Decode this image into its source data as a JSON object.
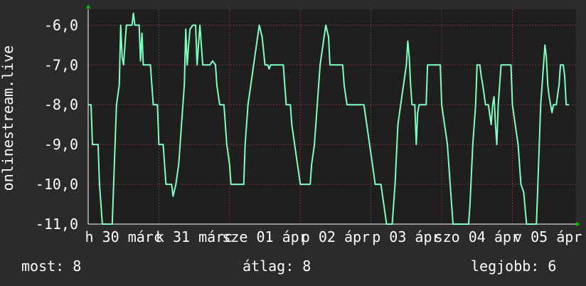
{
  "chart_data": {
    "type": "line",
    "ylabel": "onlinestream.live",
    "ylim": [
      -11,
      -5.6
    ],
    "yticks": [
      -6,
      -7,
      -8,
      -9,
      -10,
      -11
    ],
    "ytick_labels": [
      "-6,0",
      "-7,0",
      "-8,0",
      "-9,0",
      "-10,0",
      "-11,0"
    ],
    "xlim": [
      0,
      6.9
    ],
    "xtick_labels": [
      "h 30 márc",
      "k 31 márc",
      "sze 01 ápr",
      "p 02 ápr",
      "p 03 ápr",
      "szo 04 ápr",
      "v 05 ápr"
    ],
    "colors": {
      "background": "#2b2b2b",
      "plot_background": "#1f1f1f",
      "line": "#7fffc0",
      "grid": "#7a3a3a",
      "axis_arrow": "#00c000",
      "text": "#ffffff"
    },
    "series": [
      {
        "values": [
          [
            0.0,
            -8.0
          ],
          [
            0.04,
            -8.0
          ],
          [
            0.06,
            -9.0
          ],
          [
            0.14,
            -9.0
          ],
          [
            0.16,
            -10.0
          ],
          [
            0.2,
            -11.0
          ],
          [
            0.34,
            -11.0
          ],
          [
            0.36,
            -10.0
          ],
          [
            0.4,
            -8.0
          ],
          [
            0.44,
            -7.5
          ],
          [
            0.46,
            -6.0
          ],
          [
            0.48,
            -6.8
          ],
          [
            0.5,
            -7.0
          ],
          [
            0.52,
            -6.5
          ],
          [
            0.54,
            -6.0
          ],
          [
            0.6,
            -6.0
          ],
          [
            0.62,
            -6.0
          ],
          [
            0.64,
            -5.7
          ],
          [
            0.66,
            -6.0
          ],
          [
            0.72,
            -6.0
          ],
          [
            0.74,
            -6.9
          ],
          [
            0.76,
            -6.2
          ],
          [
            0.78,
            -7.0
          ],
          [
            0.88,
            -7.0
          ],
          [
            0.9,
            -7.5
          ],
          [
            0.92,
            -8.0
          ],
          [
            0.98,
            -8.0
          ],
          [
            1.0,
            -9.0
          ],
          [
            1.06,
            -9.0
          ],
          [
            1.08,
            -9.5
          ],
          [
            1.1,
            -10.0
          ],
          [
            1.18,
            -10.0
          ],
          [
            1.2,
            -10.3
          ],
          [
            1.24,
            -10.0
          ],
          [
            1.28,
            -9.5
          ],
          [
            1.32,
            -8.5
          ],
          [
            1.36,
            -7.5
          ],
          [
            1.38,
            -6.1
          ],
          [
            1.4,
            -7.0
          ],
          [
            1.42,
            -6.5
          ],
          [
            1.44,
            -6.1
          ],
          [
            1.48,
            -6.0
          ],
          [
            1.52,
            -6.0
          ],
          [
            1.54,
            -7.0
          ],
          [
            1.58,
            -6.0
          ],
          [
            1.62,
            -7.0
          ],
          [
            1.72,
            -7.0
          ],
          [
            1.76,
            -6.9
          ],
          [
            1.8,
            -7.0
          ],
          [
            1.82,
            -7.5
          ],
          [
            1.86,
            -8.0
          ],
          [
            1.92,
            -8.0
          ],
          [
            1.96,
            -9.0
          ],
          [
            2.0,
            -9.5
          ],
          [
            2.02,
            -10.0
          ],
          [
            2.2,
            -10.0
          ],
          [
            2.22,
            -9.0
          ],
          [
            2.26,
            -8.0
          ],
          [
            2.3,
            -7.5
          ],
          [
            2.34,
            -7.0
          ],
          [
            2.38,
            -6.5
          ],
          [
            2.42,
            -6.0
          ],
          [
            2.46,
            -6.3
          ],
          [
            2.5,
            -7.0
          ],
          [
            2.54,
            -7.0
          ],
          [
            2.56,
            -7.1
          ],
          [
            2.58,
            -7.0
          ],
          [
            2.76,
            -7.0
          ],
          [
            2.8,
            -8.0
          ],
          [
            2.86,
            -8.0
          ],
          [
            2.88,
            -8.5
          ],
          [
            2.92,
            -9.0
          ],
          [
            2.96,
            -9.5
          ],
          [
            3.0,
            -10.0
          ],
          [
            3.14,
            -10.0
          ],
          [
            3.16,
            -9.5
          ],
          [
            3.2,
            -9.0
          ],
          [
            3.24,
            -8.0
          ],
          [
            3.28,
            -7.0
          ],
          [
            3.32,
            -6.5
          ],
          [
            3.36,
            -6.0
          ],
          [
            3.4,
            -6.3
          ],
          [
            3.42,
            -7.0
          ],
          [
            3.6,
            -7.0
          ],
          [
            3.62,
            -7.5
          ],
          [
            3.66,
            -8.0
          ],
          [
            3.9,
            -8.0
          ],
          [
            3.94,
            -8.5
          ],
          [
            3.98,
            -9.0
          ],
          [
            4.02,
            -9.5
          ],
          [
            4.06,
            -10.0
          ],
          [
            4.14,
            -10.0
          ],
          [
            4.18,
            -10.5
          ],
          [
            4.22,
            -11.0
          ],
          [
            4.3,
            -11.0
          ],
          [
            4.34,
            -10.0
          ],
          [
            4.38,
            -8.5
          ],
          [
            4.42,
            -8.0
          ],
          [
            4.46,
            -7.5
          ],
          [
            4.5,
            -7.0
          ],
          [
            4.52,
            -6.4
          ],
          [
            4.54,
            -6.8
          ],
          [
            4.56,
            -7.5
          ],
          [
            4.58,
            -8.0
          ],
          [
            4.62,
            -8.0
          ],
          [
            4.64,
            -9.0
          ],
          [
            4.66,
            -8.2
          ],
          [
            4.68,
            -8.0
          ],
          [
            4.78,
            -8.0
          ],
          [
            4.8,
            -7.0
          ],
          [
            4.98,
            -7.0
          ],
          [
            5.0,
            -8.0
          ],
          [
            5.04,
            -8.5
          ],
          [
            5.08,
            -9.0
          ],
          [
            5.12,
            -10.0
          ],
          [
            5.16,
            -11.0
          ],
          [
            5.38,
            -11.0
          ],
          [
            5.4,
            -10.5
          ],
          [
            5.44,
            -9.0
          ],
          [
            5.48,
            -8.0
          ],
          [
            5.5,
            -7.0
          ],
          [
            5.54,
            -7.0
          ],
          [
            5.56,
            -7.3
          ],
          [
            5.58,
            -7.5
          ],
          [
            5.62,
            -8.0
          ],
          [
            5.66,
            -8.0
          ],
          [
            5.7,
            -8.5
          ],
          [
            5.72,
            -8.0
          ],
          [
            5.74,
            -7.8
          ],
          [
            5.76,
            -8.5
          ],
          [
            5.78,
            -9.0
          ],
          [
            5.8,
            -8.0
          ],
          [
            5.82,
            -7.5
          ],
          [
            5.84,
            -7.0
          ],
          [
            5.98,
            -7.0
          ],
          [
            6.0,
            -8.0
          ],
          [
            6.04,
            -8.5
          ],
          [
            6.08,
            -9.0
          ],
          [
            6.12,
            -10.0
          ],
          [
            6.16,
            -10.2
          ],
          [
            6.2,
            -11.0
          ],
          [
            6.34,
            -11.0
          ],
          [
            6.36,
            -10.0
          ],
          [
            6.4,
            -8.0
          ],
          [
            6.44,
            -7.0
          ],
          [
            6.46,
            -6.5
          ],
          [
            6.48,
            -6.8
          ],
          [
            6.5,
            -7.5
          ],
          [
            6.52,
            -7.8
          ],
          [
            6.54,
            -8.0
          ],
          [
            6.56,
            -8.2
          ],
          [
            6.58,
            -8.0
          ],
          [
            6.62,
            -8.0
          ],
          [
            6.66,
            -7.5
          ],
          [
            6.68,
            -7.0
          ],
          [
            6.72,
            -7.0
          ],
          [
            6.74,
            -7.3
          ],
          [
            6.76,
            -8.0
          ],
          [
            6.8,
            -8.0
          ]
        ]
      }
    ]
  },
  "footer": {
    "most": "most: 8",
    "atlag": "átlag: 8",
    "legjobb": "legjobb: 6"
  }
}
